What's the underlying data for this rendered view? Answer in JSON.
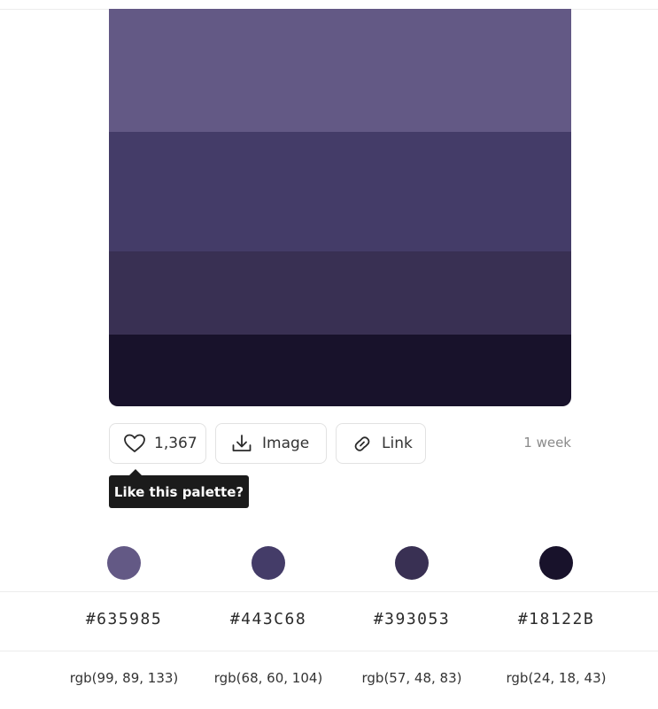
{
  "palette": {
    "colors": [
      {
        "hex": "#635985",
        "rgb": "rgb(99, 89, 133)"
      },
      {
        "hex": "#443C68",
        "rgb": "rgb(68, 60, 104)"
      },
      {
        "hex": "#393053",
        "rgb": "rgb(57, 48, 83)"
      },
      {
        "hex": "#18122B",
        "rgb": "rgb(24, 18, 43)"
      }
    ],
    "swatch_fill_fraction": [
      0.31,
      0.3,
      0.21,
      0.18
    ]
  },
  "actions": {
    "like_count": "1,367",
    "image_label": "Image",
    "link_label": "Link",
    "age": "1 week",
    "tooltip": "Like this palette?",
    "icons": {
      "like": "heart-icon",
      "image": "download-icon",
      "link": "link-icon"
    }
  }
}
